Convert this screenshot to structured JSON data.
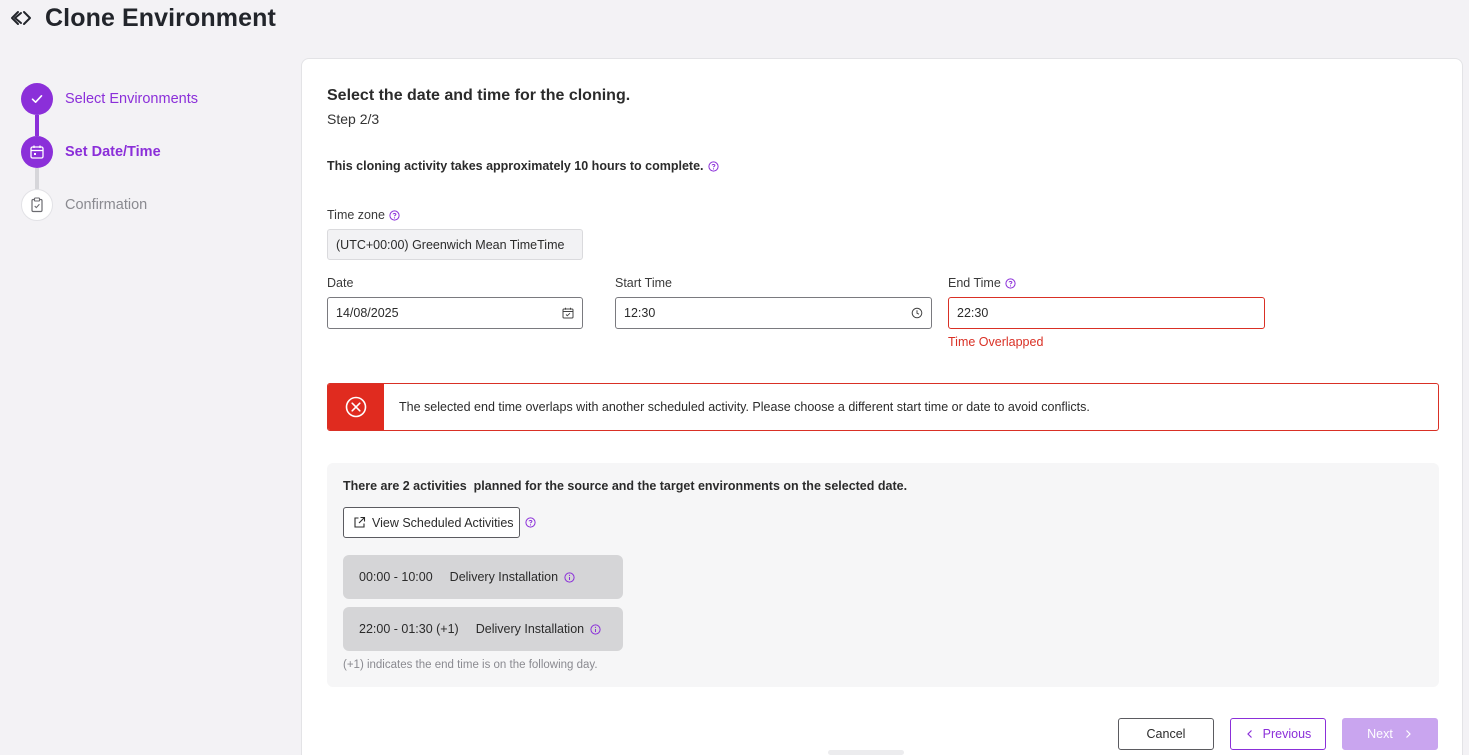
{
  "header": {
    "title": "Clone Environment",
    "back_icon": "code-arrows-icon"
  },
  "stepper": {
    "steps": [
      {
        "label": "Select Environments",
        "state": "completed",
        "icon": "check-icon"
      },
      {
        "label": "Set Date/Time",
        "state": "active",
        "icon": "calendar-icon"
      },
      {
        "label": "Confirmation",
        "state": "pending",
        "icon": "clipboard-icon"
      }
    ]
  },
  "main": {
    "title": "Select the date and time for the cloning.",
    "step_indicator": "Step 2/3",
    "duration_note": "This cloning activity takes approximately 10 hours to complete.",
    "timezone": {
      "label": "Time zone",
      "value": "(UTC+00:00) Greenwich Mean TimeTime"
    },
    "date": {
      "label": "Date",
      "value": "14/08/2025"
    },
    "start_time": {
      "label": "Start Time",
      "value": "12:30"
    },
    "end_time": {
      "label": "End Time",
      "value": "22:30",
      "error": "Time Overlapped"
    },
    "alert": {
      "message": "The selected end time overlaps with another scheduled activity. Please choose a different start time or date to avoid conflicts."
    },
    "activities": {
      "title": "There are 2 activities  planned for the source and the target environments on the selected date.",
      "view_button": "View Scheduled Activities",
      "items": [
        {
          "time": "00:00 - 10:00",
          "name": "Delivery Installation"
        },
        {
          "time": "22:00 - 01:30 (+1)",
          "name": "Delivery Installation"
        }
      ],
      "note": "(+1) indicates the end time is on the following day."
    }
  },
  "footer": {
    "cancel": "Cancel",
    "previous": "Previous",
    "next": "Next"
  },
  "colors": {
    "accent": "#8b2fd9",
    "error": "#d93025",
    "disabled": "#c9a5ef"
  }
}
